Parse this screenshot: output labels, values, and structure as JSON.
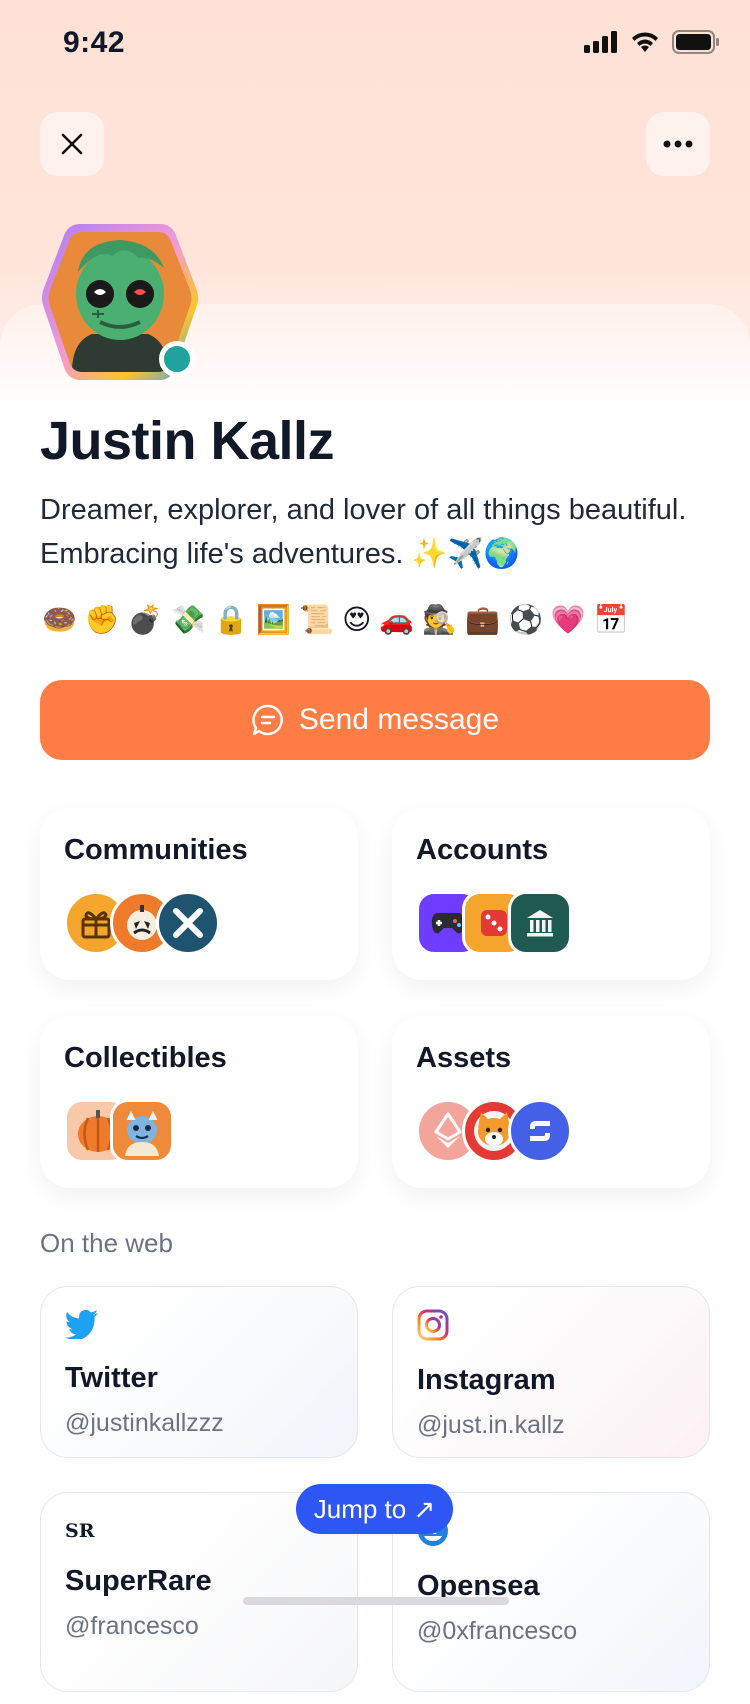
{
  "status_bar": {
    "time": "9:42"
  },
  "profile": {
    "name": "Justin Kallz",
    "bio": "Dreamer, explorer, and lover of all things beautiful. Embracing life's adventures. ✨✈️🌍",
    "emojis": [
      "🍩",
      "✊",
      "💣",
      "💸",
      "🔒",
      "🖼️",
      "📜",
      "😍",
      "🚗",
      "🕵️",
      "💼",
      "⚽",
      "💗",
      "📅"
    ],
    "online": true
  },
  "actions": {
    "send_message": "Send message",
    "jump_to": "Jump to ↗"
  },
  "cards": {
    "communities": {
      "title": "Communities",
      "icons": [
        "gift-icon",
        "pumpkin-icon",
        "x-logo-icon"
      ]
    },
    "accounts": {
      "title": "Accounts",
      "icons": [
        "gamepad-icon",
        "dice-icon",
        "bank-icon"
      ]
    },
    "collectibles": {
      "title": "Collectibles",
      "icons": [
        "pumpkin-nft-icon",
        "monster-nft-icon"
      ]
    },
    "assets": {
      "title": "Assets",
      "icons": [
        "ethereum-icon",
        "shiba-icon",
        "solana-icon"
      ]
    }
  },
  "web": {
    "label": "On the web",
    "items": [
      {
        "name": "Twitter",
        "handle": "@justinkallzzz",
        "icon": "twitter-icon"
      },
      {
        "name": "Instagram",
        "handle": "@just.in.kallz",
        "icon": "instagram-icon"
      },
      {
        "name": "SuperRare",
        "handle": "@francesco",
        "icon": "superrare-icon"
      },
      {
        "name": "Opensea",
        "handle": "@0xfrancesco",
        "icon": "opensea-icon"
      }
    ]
  },
  "colors": {
    "accent": "#ff7c45",
    "jump": "#2e56f5",
    "header_bg": "#ffe1d6",
    "online": "#20a39e"
  }
}
